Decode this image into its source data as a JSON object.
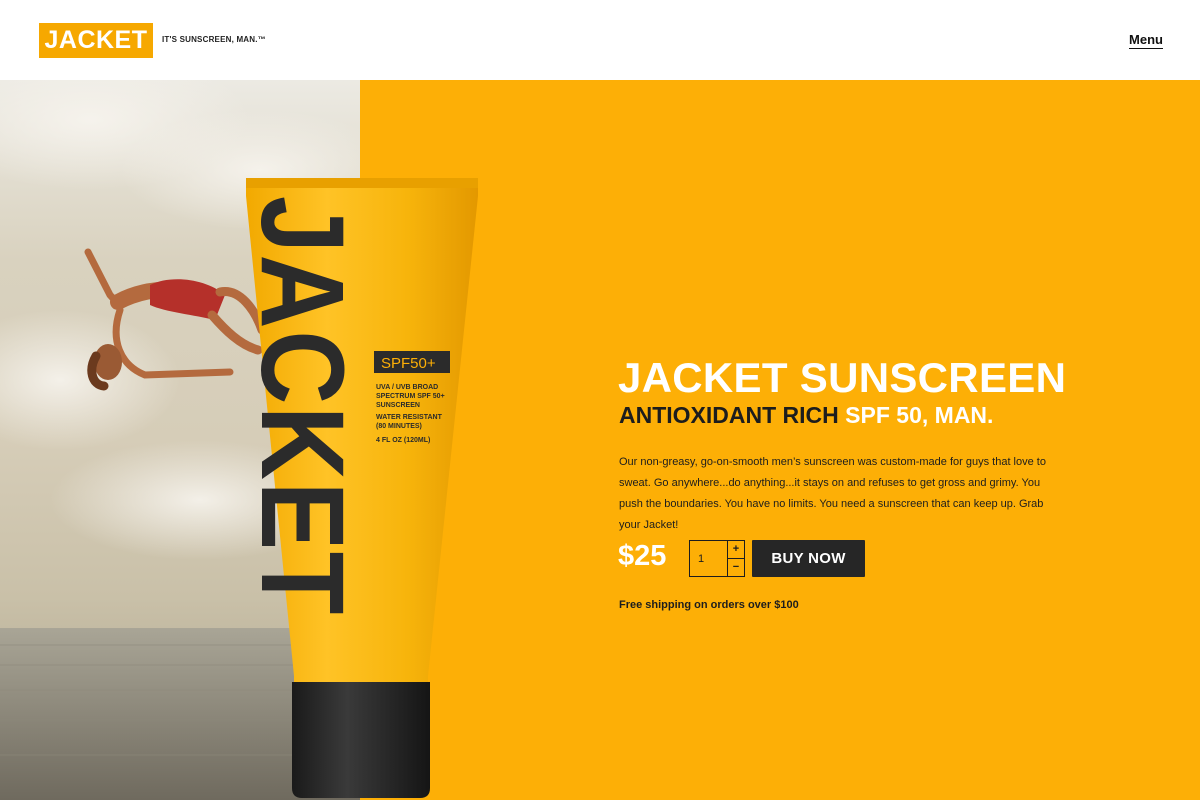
{
  "header": {
    "logo": "JACKET",
    "tagline": "IT'S SUNSCREEN, MAN.™",
    "menu_label": "Menu"
  },
  "tube": {
    "brand": "JACKET",
    "spf_badge": "SPF50+",
    "spec_lines": [
      "UVA / UVB BROAD",
      "SPECTRUM SPF 50+",
      "SUNSCREEN"
    ],
    "water_lines": [
      "WATER RESISTANT",
      "(80 MINUTES)"
    ],
    "volume": "4 FL OZ (120ML)"
  },
  "product": {
    "title": "JACKET SUNSCREEN",
    "subtitle_lead": "ANTIOXIDANT RICH ",
    "subtitle_highlight": "SPF 50, MAN.",
    "description": "Our non-greasy, go-on-smooth men’s sunscreen was custom-made for guys that love to sweat. Go anywhere...do anything...it stays on and refuses to get gross and grimy. You push the boundaries. You have no limits. You need a sunscreen that can keep up. Grab your Jacket!",
    "price": "$25",
    "quantity": "1",
    "qty_increase": "+",
    "qty_decrease": "−",
    "buy_label": "BUY NOW",
    "shipping_note": "Free shipping on orders over $100"
  },
  "colors": {
    "brand_yellow": "#fdaf06",
    "logo_yellow": "#f6a800",
    "dark": "#1d1d1d",
    "button": "#262626"
  }
}
